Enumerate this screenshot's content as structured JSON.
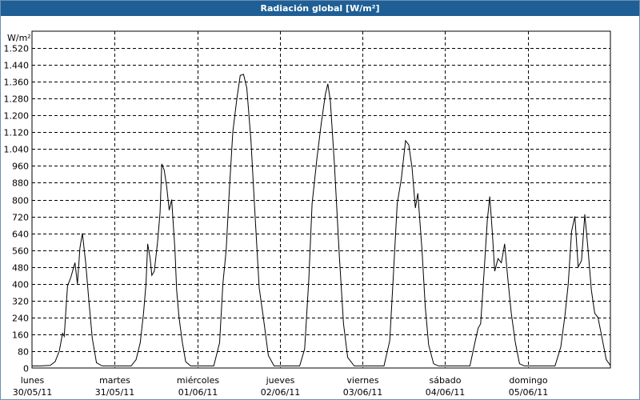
{
  "title": "Radiación global [W/m²]",
  "chart_data": {
    "type": "line",
    "title": "Radiación global [W/m²]",
    "ylabel": "W/m²",
    "xlabel": "",
    "ylim": [
      0,
      1600
    ],
    "yticks": [
      0,
      80,
      160,
      240,
      320,
      400,
      480,
      560,
      640,
      720,
      800,
      880,
      960,
      1040,
      1120,
      1200,
      1280,
      1360,
      1440,
      1520
    ],
    "ytick_labels": [
      "0",
      "80",
      "160",
      "240",
      "320",
      "400",
      "480",
      "560",
      "640",
      "720",
      "800",
      "880",
      "960",
      "1.040",
      "1.120",
      "1.200",
      "1.280",
      "1.360",
      "1.440",
      "1.520"
    ],
    "xlim": [
      0,
      7
    ],
    "x_unit": "days since lunes 30/05/11",
    "x_ticks": [
      {
        "day": "lunes",
        "date": "30/05/11",
        "x": 0
      },
      {
        "day": "martes",
        "date": "31/05/11",
        "x": 1
      },
      {
        "day": "miércoles",
        "date": "01/06/11",
        "x": 2
      },
      {
        "day": "jueves",
        "date": "02/06/11",
        "x": 3
      },
      {
        "day": "viernes",
        "date": "03/06/11",
        "x": 4
      },
      {
        "day": "sábado",
        "date": "04/06/11",
        "x": 5
      },
      {
        "day": "domingo",
        "date": "05/06/11",
        "x": 6
      }
    ],
    "grid": true,
    "colors": {
      "line": "#000000",
      "grid": "#000000",
      "title_bg": "#1f5f95"
    },
    "series": [
      {
        "name": "",
        "points": [
          [
            0.0,
            10
          ],
          [
            0.1,
            10
          ],
          [
            0.22,
            12
          ],
          [
            0.28,
            30
          ],
          [
            0.33,
            80
          ],
          [
            0.37,
            165
          ],
          [
            0.39,
            150
          ],
          [
            0.41,
            270
          ],
          [
            0.43,
            390
          ],
          [
            0.47,
            430
          ],
          [
            0.52,
            500
          ],
          [
            0.55,
            400
          ],
          [
            0.58,
            570
          ],
          [
            0.61,
            640
          ],
          [
            0.65,
            500
          ],
          [
            0.69,
            310
          ],
          [
            0.73,
            140
          ],
          [
            0.78,
            25
          ],
          [
            0.85,
            10
          ],
          [
            1.0,
            10
          ],
          [
            1.2,
            10
          ],
          [
            1.26,
            40
          ],
          [
            1.31,
            120
          ],
          [
            1.35,
            260
          ],
          [
            1.38,
            400
          ],
          [
            1.4,
            590
          ],
          [
            1.43,
            520
          ],
          [
            1.45,
            440
          ],
          [
            1.48,
            460
          ],
          [
            1.52,
            600
          ],
          [
            1.55,
            740
          ],
          [
            1.57,
            970
          ],
          [
            1.6,
            940
          ],
          [
            1.63,
            860
          ],
          [
            1.66,
            750
          ],
          [
            1.69,
            800
          ],
          [
            1.73,
            560
          ],
          [
            1.75,
            370
          ],
          [
            1.78,
            240
          ],
          [
            1.82,
            120
          ],
          [
            1.86,
            30
          ],
          [
            1.92,
            10
          ],
          [
            2.0,
            10
          ],
          [
            2.2,
            10
          ],
          [
            2.27,
            120
          ],
          [
            2.31,
            400
          ],
          [
            2.35,
            560
          ],
          [
            2.39,
            860
          ],
          [
            2.43,
            1120
          ],
          [
            2.48,
            1280
          ],
          [
            2.52,
            1390
          ],
          [
            2.56,
            1395
          ],
          [
            2.6,
            1330
          ],
          [
            2.65,
            1080
          ],
          [
            2.7,
            720
          ],
          [
            2.75,
            380
          ],
          [
            2.8,
            240
          ],
          [
            2.86,
            60
          ],
          [
            2.93,
            10
          ],
          [
            3.0,
            10
          ],
          [
            3.24,
            10
          ],
          [
            3.3,
            90
          ],
          [
            3.35,
            420
          ],
          [
            3.39,
            780
          ],
          [
            3.45,
            1000
          ],
          [
            3.5,
            1160
          ],
          [
            3.55,
            1300
          ],
          [
            3.58,
            1350
          ],
          [
            3.61,
            1270
          ],
          [
            3.66,
            970
          ],
          [
            3.72,
            530
          ],
          [
            3.77,
            210
          ],
          [
            3.82,
            50
          ],
          [
            3.9,
            10
          ],
          [
            4.0,
            10
          ],
          [
            4.26,
            10
          ],
          [
            4.33,
            130
          ],
          [
            4.37,
            420
          ],
          [
            4.42,
            780
          ],
          [
            4.47,
            900
          ],
          [
            4.52,
            1080
          ],
          [
            4.56,
            1060
          ],
          [
            4.6,
            950
          ],
          [
            4.64,
            760
          ],
          [
            4.67,
            830
          ],
          [
            4.72,
            560
          ],
          [
            4.76,
            290
          ],
          [
            4.8,
            110
          ],
          [
            4.86,
            20
          ],
          [
            4.92,
            10
          ],
          [
            5.0,
            10
          ],
          [
            5.3,
            10
          ],
          [
            5.36,
            120
          ],
          [
            5.4,
            190
          ],
          [
            5.43,
            210
          ],
          [
            5.47,
            450
          ],
          [
            5.51,
            700
          ],
          [
            5.54,
            815
          ],
          [
            5.57,
            650
          ],
          [
            5.6,
            460
          ],
          [
            5.64,
            520
          ],
          [
            5.68,
            500
          ],
          [
            5.72,
            590
          ],
          [
            5.76,
            420
          ],
          [
            5.8,
            260
          ],
          [
            5.85,
            120
          ],
          [
            5.9,
            20
          ],
          [
            5.96,
            10
          ],
          [
            6.0,
            10
          ],
          [
            6.33,
            10
          ],
          [
            6.4,
            100
          ],
          [
            6.45,
            250
          ],
          [
            6.49,
            400
          ],
          [
            6.53,
            650
          ],
          [
            6.57,
            720
          ],
          [
            6.61,
            480
          ],
          [
            6.65,
            510
          ],
          [
            6.69,
            730
          ],
          [
            6.73,
            560
          ],
          [
            6.77,
            370
          ],
          [
            6.81,
            260
          ],
          [
            6.85,
            240
          ],
          [
            6.9,
            140
          ],
          [
            6.95,
            40
          ],
          [
            7.0,
            12
          ]
        ]
      }
    ]
  }
}
